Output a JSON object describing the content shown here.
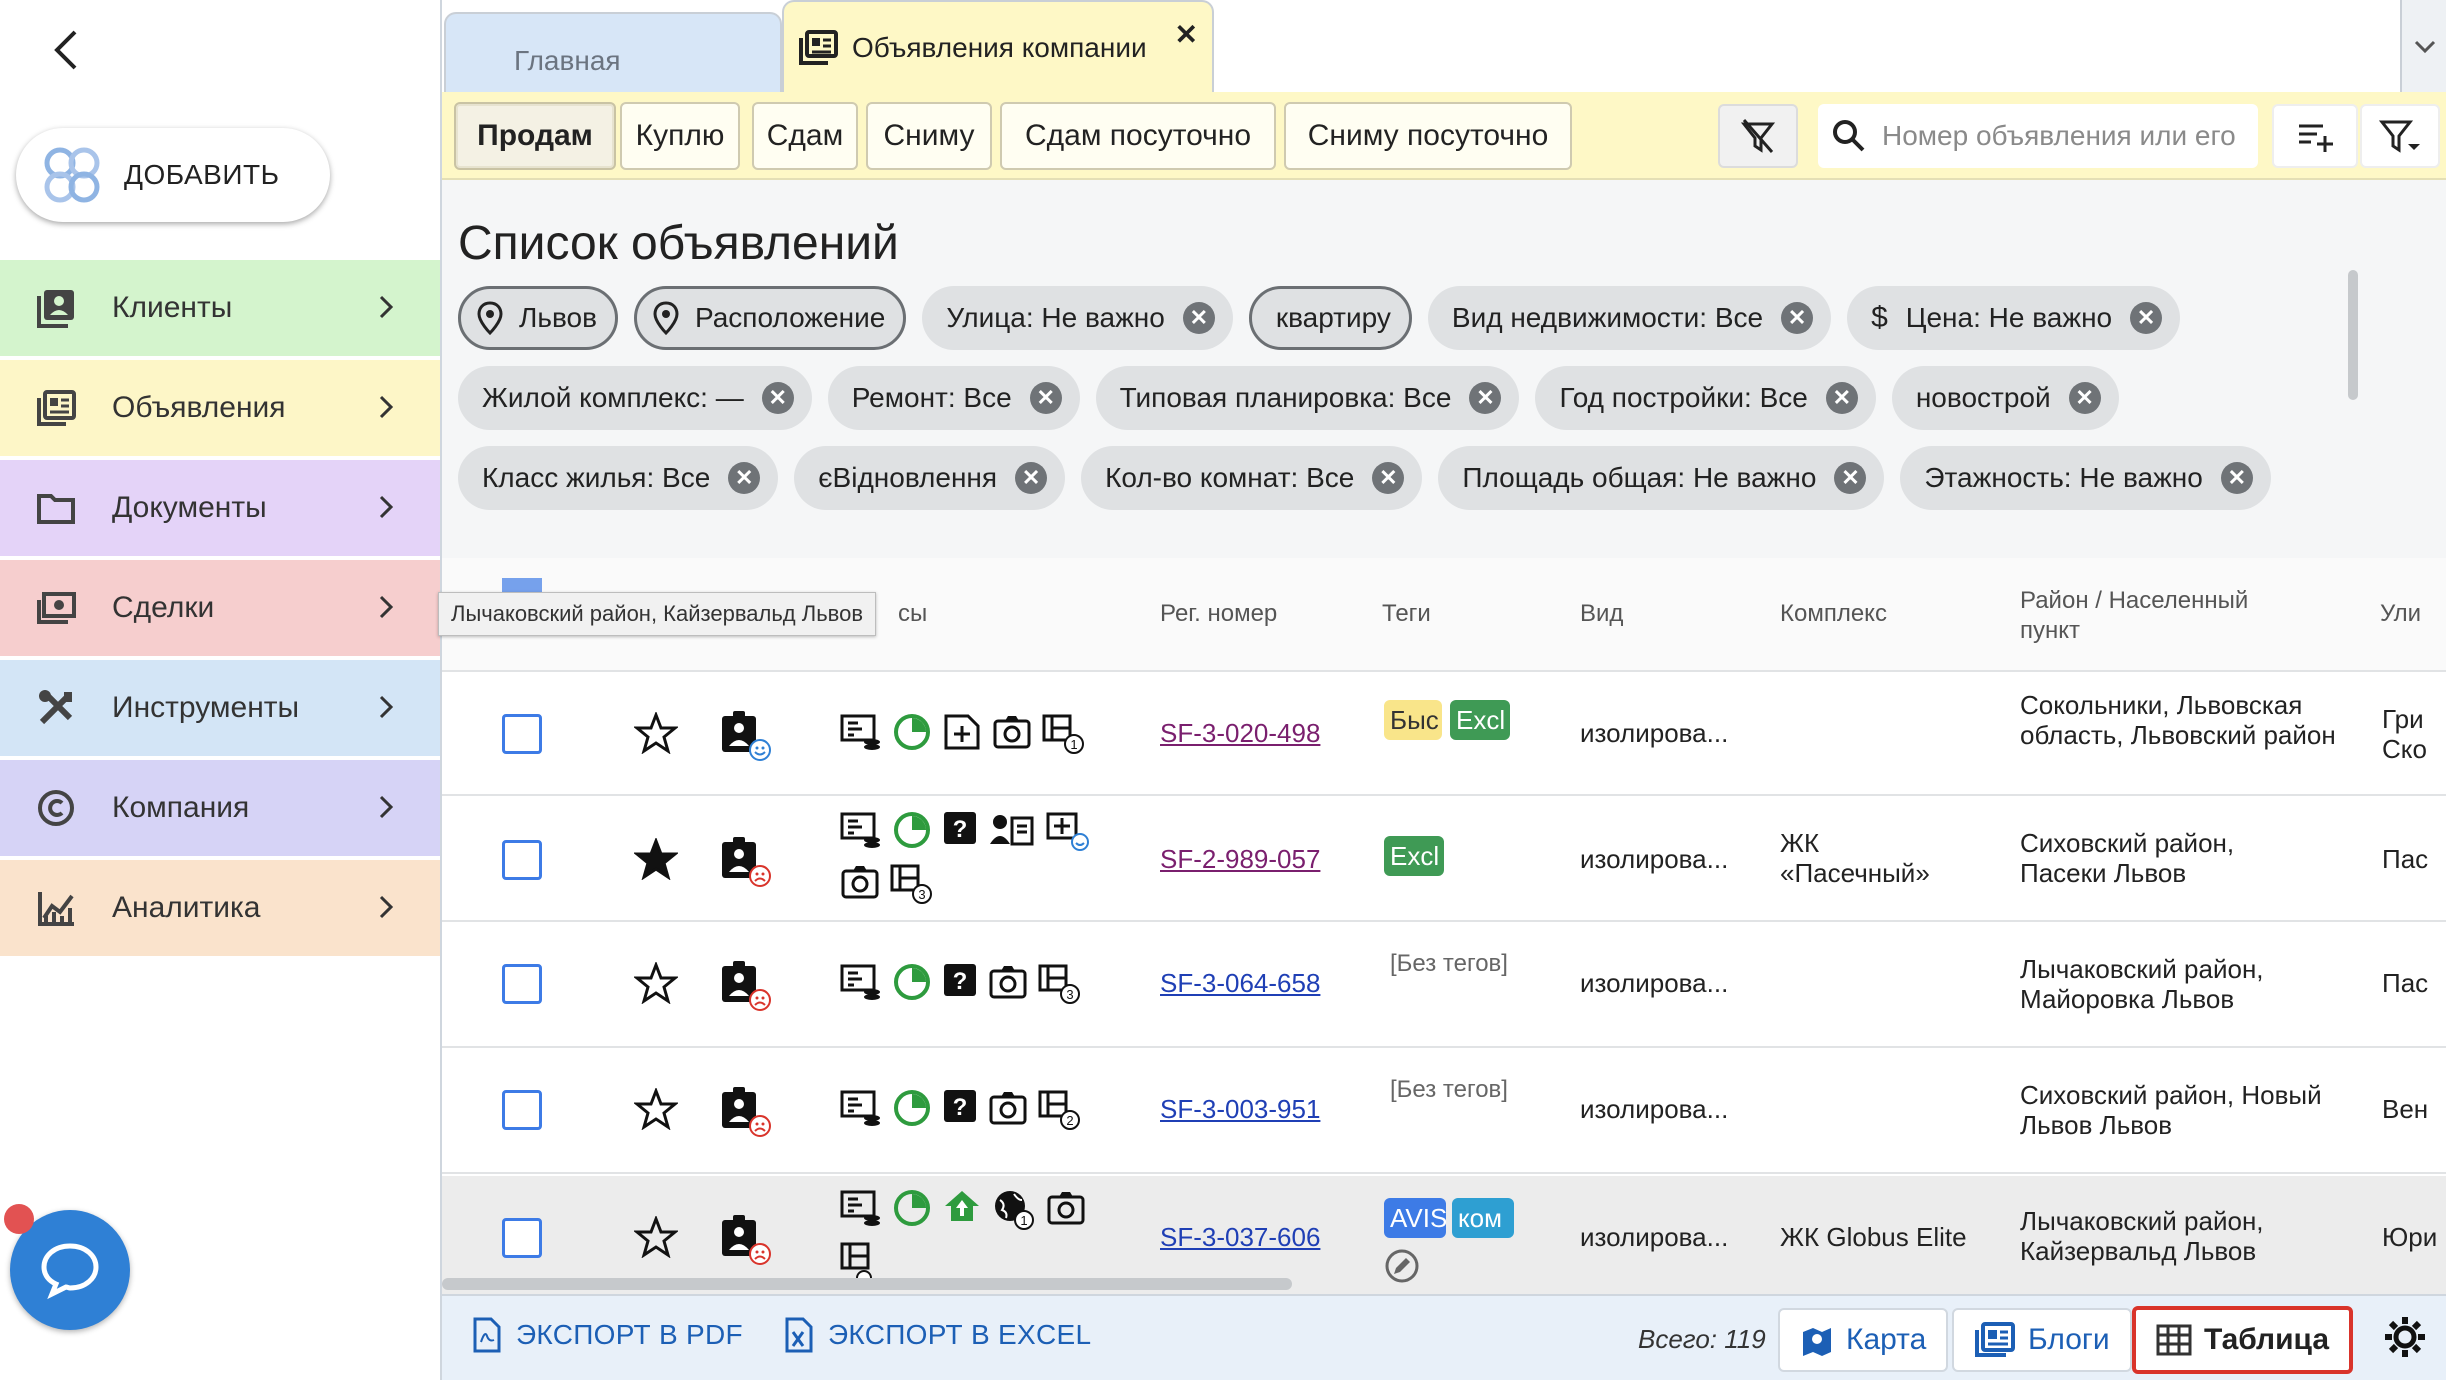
{
  "sidebar": {
    "add_label": "ДОБАВИТЬ",
    "items": [
      {
        "label": "Клиенты",
        "icon": "clients-icon",
        "color": "#d4f4cd"
      },
      {
        "label": "Объявления",
        "icon": "listings-icon",
        "color": "#fdf6c7"
      },
      {
        "label": "Документы",
        "icon": "folder-icon",
        "color": "#e4d3f8"
      },
      {
        "label": "Сделки",
        "icon": "money-icon",
        "color": "#f6cece"
      },
      {
        "label": "Инструменты",
        "icon": "tools-icon",
        "color": "#d3e5f6"
      },
      {
        "label": "Компания",
        "icon": "copyright-icon",
        "color": "#d6d3f6"
      },
      {
        "label": "Аналитика",
        "icon": "analytics-icon",
        "color": "#fae3cc"
      }
    ]
  },
  "tabs": {
    "home": "Главная",
    "active": "Объявления компании",
    "close": "✕"
  },
  "toolbar": {
    "chips": [
      "Продам",
      "Куплю",
      "Сдам",
      "Сниму",
      "Сдам посуточно",
      "Сниму посуточно"
    ],
    "active_chip": "Продам",
    "search_placeholder": "Номер объявления или его"
  },
  "list": {
    "title": "Список объявлений",
    "filters_row1": [
      {
        "label": "Львов",
        "pin": true,
        "outlined": true,
        "removable": false
      },
      {
        "label": "Расположение",
        "pin": true,
        "outlined": true,
        "removable": false
      },
      {
        "label": "Улица: Не важно",
        "removable": true
      },
      {
        "label": "квартиру",
        "outlined": true,
        "removable": false
      },
      {
        "label": "Вид недвижимости: Все",
        "removable": true
      },
      {
        "label": "Цена: Не важно",
        "dollar": true,
        "removable": true
      }
    ],
    "filters_row2": [
      {
        "label": "Жилой комплекс: —",
        "removable": true
      },
      {
        "label": "Ремонт: Все",
        "removable": true
      },
      {
        "label": "Типовая планировка: Все",
        "removable": true
      },
      {
        "label": "Год постройки: Все",
        "removable": true
      },
      {
        "label": "новострой",
        "removable": true
      }
    ],
    "filters_row3": [
      {
        "label": "Класс жилья: Все",
        "removable": true
      },
      {
        "label": "єВідновлення",
        "removable": true
      },
      {
        "label": "Кол-во комнат: Все",
        "removable": true
      },
      {
        "label": "Площадь общая: Не важно",
        "removable": true
      },
      {
        "label": "Этажность: Не важно",
        "removable": true
      }
    ]
  },
  "table": {
    "headers": {
      "status": "сы",
      "regno": "Рег. номер",
      "tags": "Теги",
      "type": "Вид",
      "complex": "Комплекс",
      "district": "Район / Населенный пункт",
      "street": "Ули"
    },
    "tooltip": "Лычаковский район, Кайзервальд Львов",
    "rows": [
      {
        "regno": "SF-3-020-498",
        "visited": true,
        "starred": false,
        "owner_mood": "happy",
        "tags": [
          {
            "text": "Быс",
            "bg": "#f9e58a",
            "fg": "#333"
          },
          {
            "text": "Excl",
            "bg": "#3f9a55",
            "fg": "#fff"
          }
        ],
        "no_tags": "",
        "type": "изолирова...",
        "complex": "",
        "district": "Сокольники, Львовская область, Львовский район",
        "street": "Гри Ско"
      },
      {
        "regno": "SF-2-989-057",
        "visited": true,
        "starred": true,
        "owner_mood": "sad",
        "tags": [
          {
            "text": "Excl",
            "bg": "#3f9a55",
            "fg": "#fff"
          }
        ],
        "no_tags": "",
        "type": "изолирова...",
        "complex": "ЖК «Пасечный»",
        "district": "Сиховский район, Пасеки Львов",
        "street": "Пас"
      },
      {
        "regno": "SF-3-064-658",
        "visited": false,
        "starred": false,
        "owner_mood": "sad",
        "tags": [],
        "no_tags": "[Без тегов]",
        "type": "изолирова...",
        "complex": "",
        "district": "Лычаковский район, Майоровка Львов",
        "street": "Пас"
      },
      {
        "regno": "SF-3-003-951",
        "visited": false,
        "starred": false,
        "owner_mood": "sad",
        "tags": [],
        "no_tags": "[Без тегов]",
        "type": "изолирова...",
        "complex": "",
        "district": "Сиховский район, Новый Львов Львов",
        "street": "Вен"
      },
      {
        "regno": "SF-3-037-606",
        "visited": false,
        "starred": false,
        "owner_mood": "sad",
        "tags": [
          {
            "text": "AVIS",
            "bg": "#3d7be6",
            "fg": "#fff"
          },
          {
            "text": "ком",
            "bg": "#2e9fd2",
            "fg": "#fff"
          }
        ],
        "no_tags": "",
        "type": "изолирова...",
        "complex": "ЖК Globus Elite",
        "district": "Лычаковский район, Кайзервальд Львов",
        "street": "Юри"
      }
    ]
  },
  "footer": {
    "export_pdf": "ЭКСПОРТ В PDF",
    "export_excel": "ЭКСПОРТ В EXCEL",
    "total": "Всего: 119",
    "map": "Карта",
    "blogs": "Блоги",
    "table": "Таблица"
  },
  "colors": {
    "accent": "#1c5fb5",
    "link": "#1f3fb5",
    "visited": "#7a1f6e",
    "selected_border": "#d9342b"
  }
}
